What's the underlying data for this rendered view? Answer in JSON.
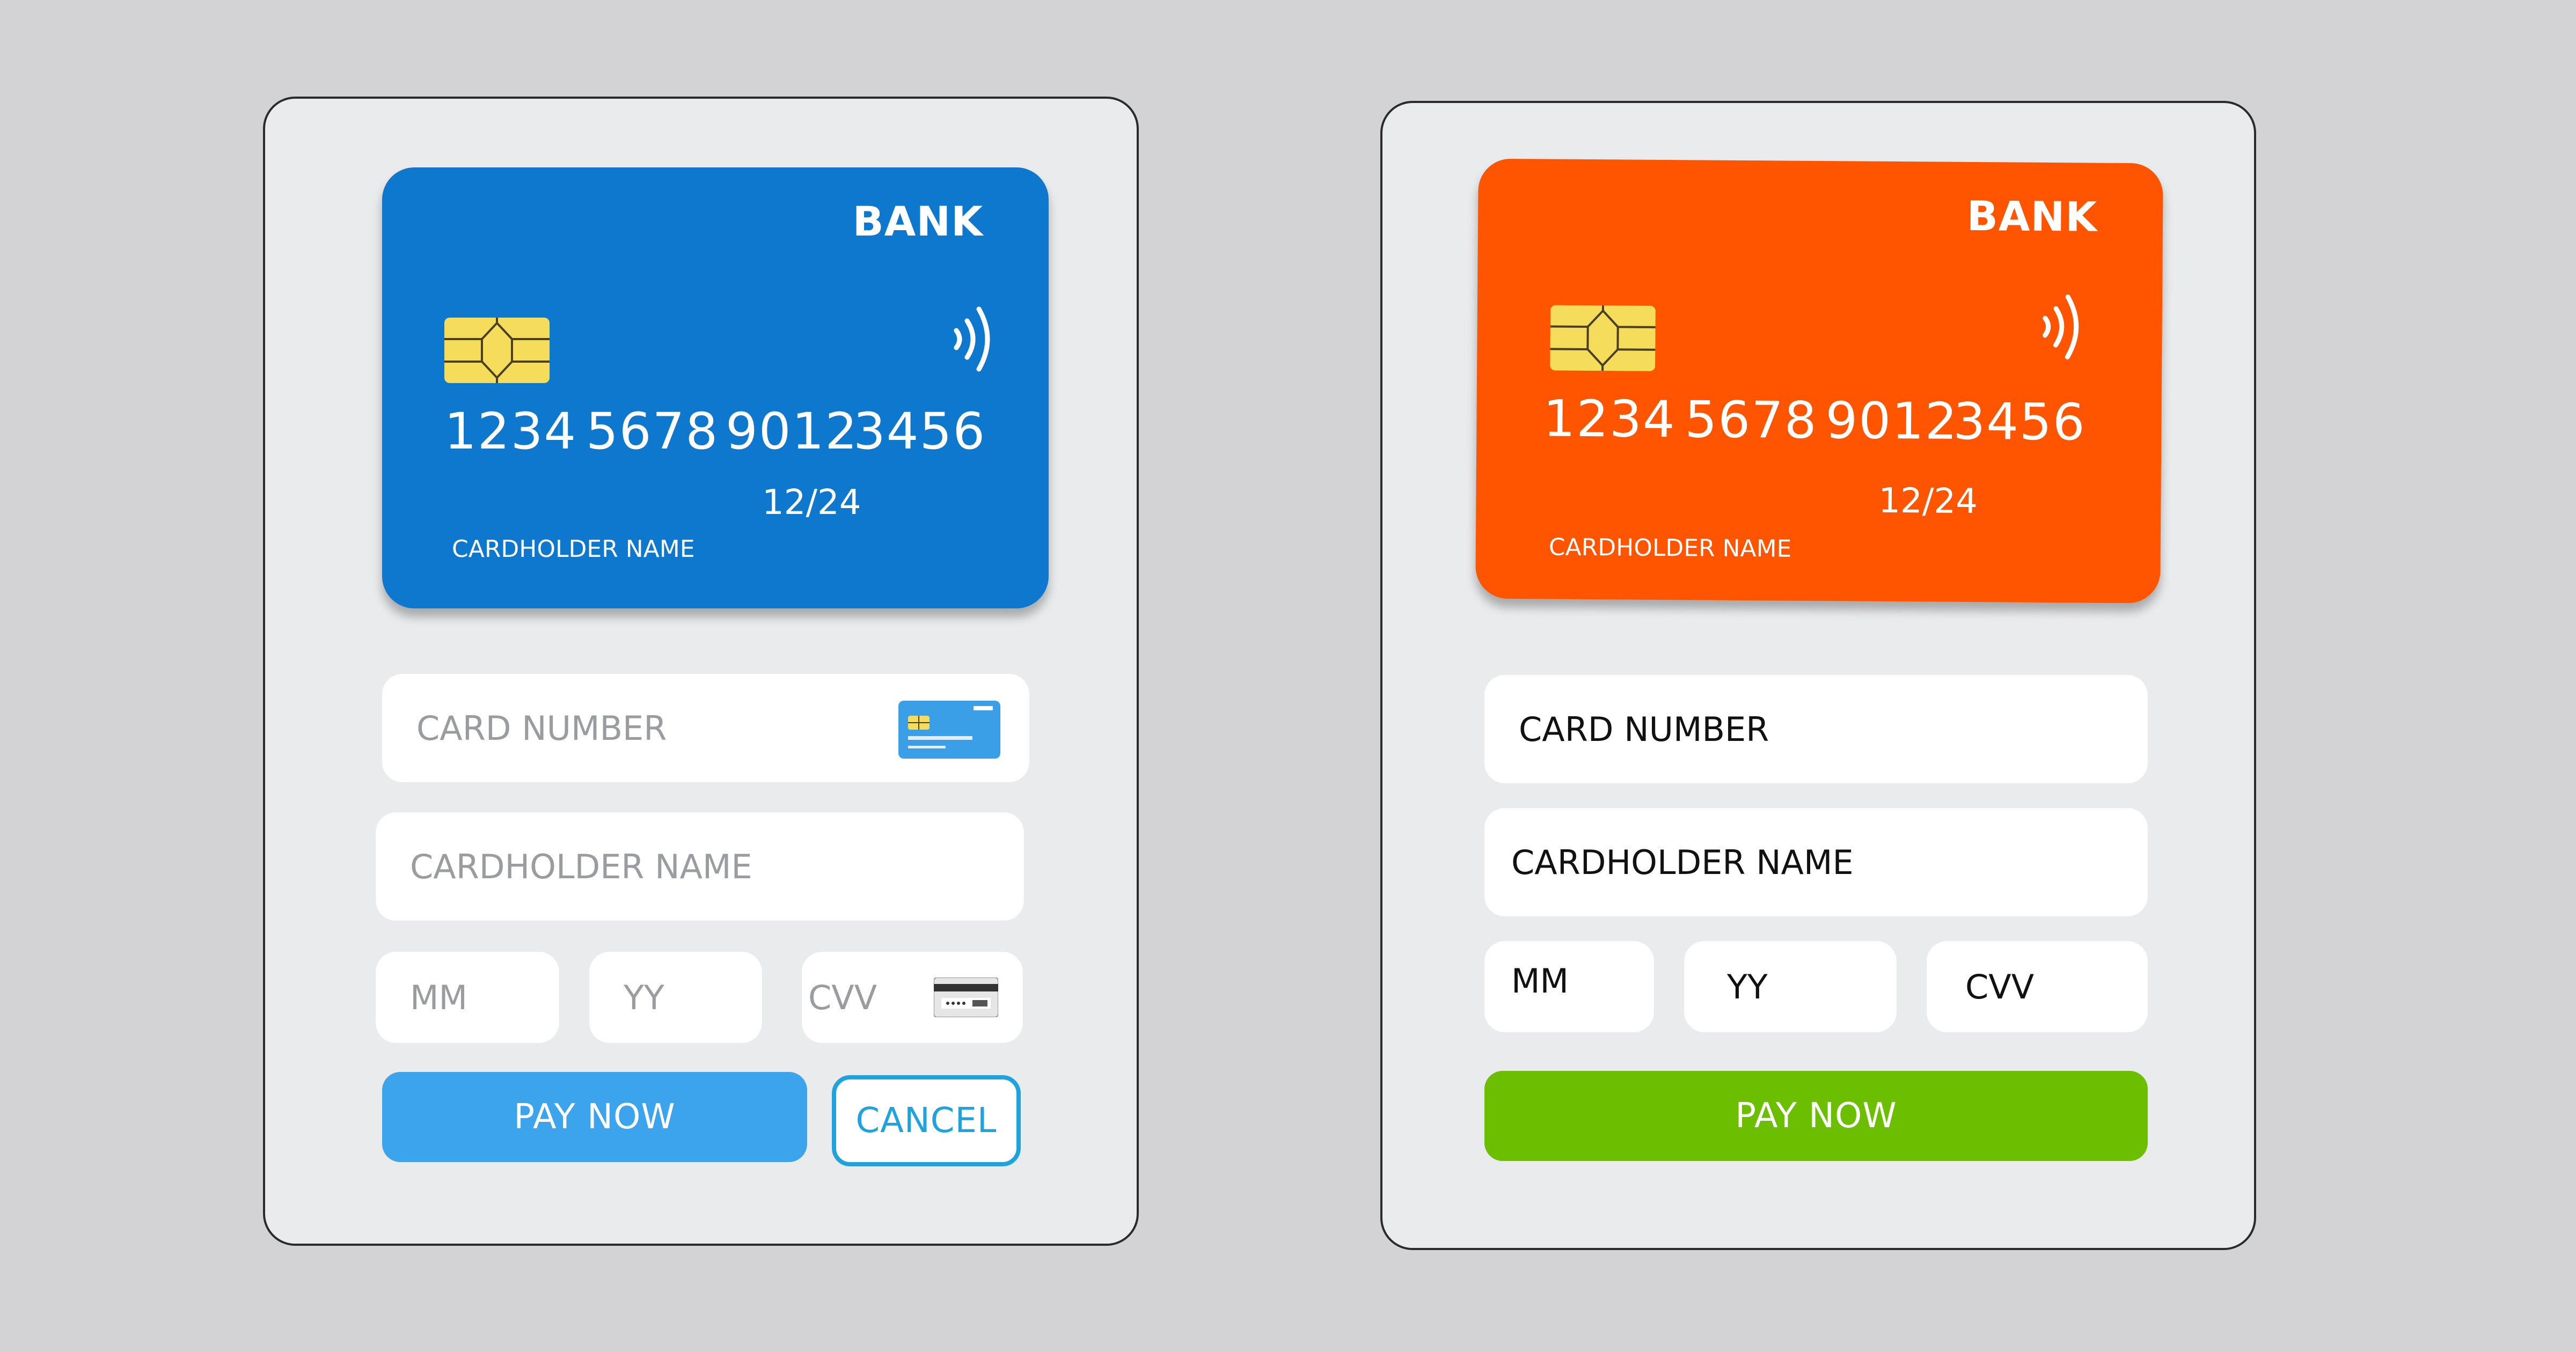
{
  "colors": {
    "background": "#d3d3d5",
    "panel": "#eaebed",
    "card_blue": "#0e78cf",
    "card_orange": "#ff5500",
    "chip": "#f5dc5a",
    "pay_blue": "#3ba4ec",
    "cancel_outline": "#1ea3df",
    "pay_green": "#6cbf00"
  },
  "left_form": {
    "card": {
      "bank": "BANK",
      "number_groups": [
        "1234",
        "5678",
        "9012",
        "3456"
      ],
      "expiry": "12/24",
      "holder": "CARDHOLDER NAME",
      "icons": [
        "chip-icon",
        "contactless-icon"
      ]
    },
    "fields": {
      "card_number": "CARD NUMBER",
      "cardholder_name": "CARDHOLDER NAME",
      "mm": "MM",
      "yy": "YY",
      "cvv": "CVV"
    },
    "field_icons": [
      "card-thumbnail-icon",
      "cvv-card-icon"
    ],
    "buttons": {
      "pay": "PAY NOW",
      "cancel": "CANCEL"
    }
  },
  "right_form": {
    "card": {
      "bank": "BANK",
      "number_groups": [
        "1234",
        "5678",
        "9012",
        "3456"
      ],
      "expiry": "12/24",
      "holder": "CARDHOLDER NAME",
      "icons": [
        "chip-icon",
        "contactless-icon"
      ]
    },
    "fields": {
      "card_number": "CARD NUMBER",
      "cardholder_name": "CARDHOLDER NAME",
      "mm": "MM",
      "yy": "YY",
      "cvv": "CVV"
    },
    "buttons": {
      "pay": "PAY NOW"
    }
  }
}
